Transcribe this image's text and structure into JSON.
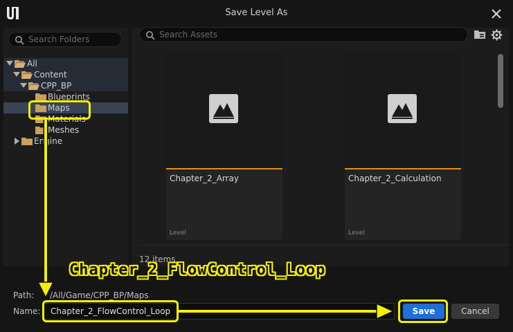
{
  "window": {
    "title": "Save Level As"
  },
  "folders": {
    "search_placeholder": "Search Folders",
    "tree": [
      {
        "label": "All",
        "expanded": true
      },
      {
        "label": "Content",
        "expanded": true
      },
      {
        "label": "CPP_BP",
        "expanded": true
      },
      {
        "label": "Blueprints"
      },
      {
        "label": "Maps",
        "selected": true
      },
      {
        "label": "Materials"
      },
      {
        "label": "Meshes"
      },
      {
        "label": "Engine",
        "expanded": false
      }
    ]
  },
  "assets": {
    "search_placeholder": "Search Assets",
    "items": [
      {
        "name": "Chapter_2_Array",
        "type": "Level"
      },
      {
        "name": "Chapter_2_Calculation",
        "type": "Level"
      }
    ],
    "count_label": "12 items"
  },
  "footer": {
    "path_label": "Path:",
    "path_value": "/All/Game/CPP_BP/Maps",
    "name_label": "Name:",
    "name_value": "Chapter_2_FlowControl_Loop",
    "save_label": "Save",
    "cancel_label": "Cancel"
  },
  "annotation": {
    "callout_text": "Chapter_2_FlowControl_Loop"
  },
  "colors": {
    "accent": "#1f6fd6",
    "highlight": "#f5f000",
    "asset_bar": "#e09020",
    "selection": "#3b4455"
  }
}
